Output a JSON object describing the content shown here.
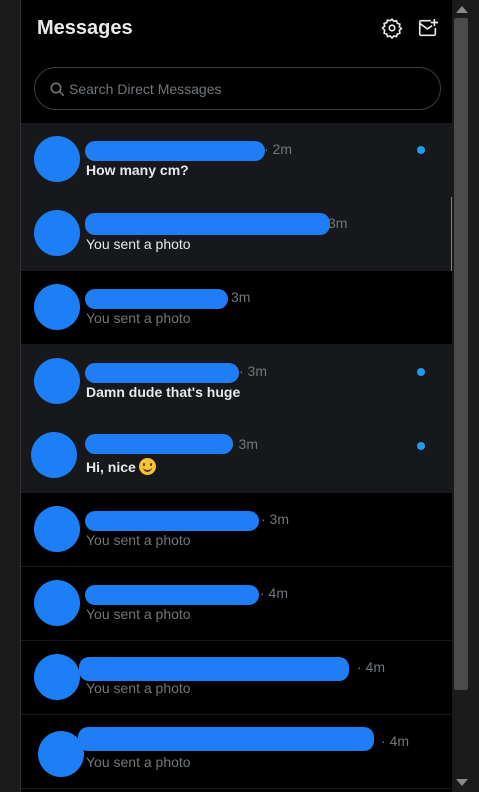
{
  "header": {
    "title": "Messages",
    "settings_icon": "gear-icon",
    "new_message_icon": "new-message-icon"
  },
  "search": {
    "placeholder": "Search Direct Messages",
    "icon": "search-icon"
  },
  "colors": {
    "accent": "#1d9bf0",
    "redaction": "#1f7ef5",
    "background": "#000000",
    "muted_text": "#71767b"
  },
  "conversations": [
    {
      "time": "· 2m",
      "preview": "How many cm?",
      "unread": true
    },
    {
      "time": "3m",
      "preview": "You sent a photo",
      "selected": true
    },
    {
      "time": "3m",
      "preview": "You sent a photo"
    },
    {
      "time": "· 3m",
      "preview": "Damn dude that's huge",
      "unread": true
    },
    {
      "time": "· 3m",
      "preview": "Hi, nice",
      "unread": true,
      "emoji": "slightly-smiling-face-emoji"
    },
    {
      "time": "· 3m",
      "preview": "You sent a photo"
    },
    {
      "time": "· 4m",
      "preview": "You sent a photo"
    },
    {
      "time": "· 4m",
      "preview": "You sent a photo"
    },
    {
      "time": "· 4m",
      "preview": "You sent a photo"
    }
  ]
}
